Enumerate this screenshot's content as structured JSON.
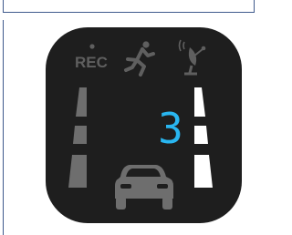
{
  "icon": {
    "rec_label": "REC",
    "speed_value": "3",
    "colors": {
      "background": "#1e1e1e",
      "digit": "#29b6f0",
      "lane_dim": "#6e6e6e",
      "lane_bright": "#ffffff",
      "indicator": "#5f5f5f"
    }
  }
}
